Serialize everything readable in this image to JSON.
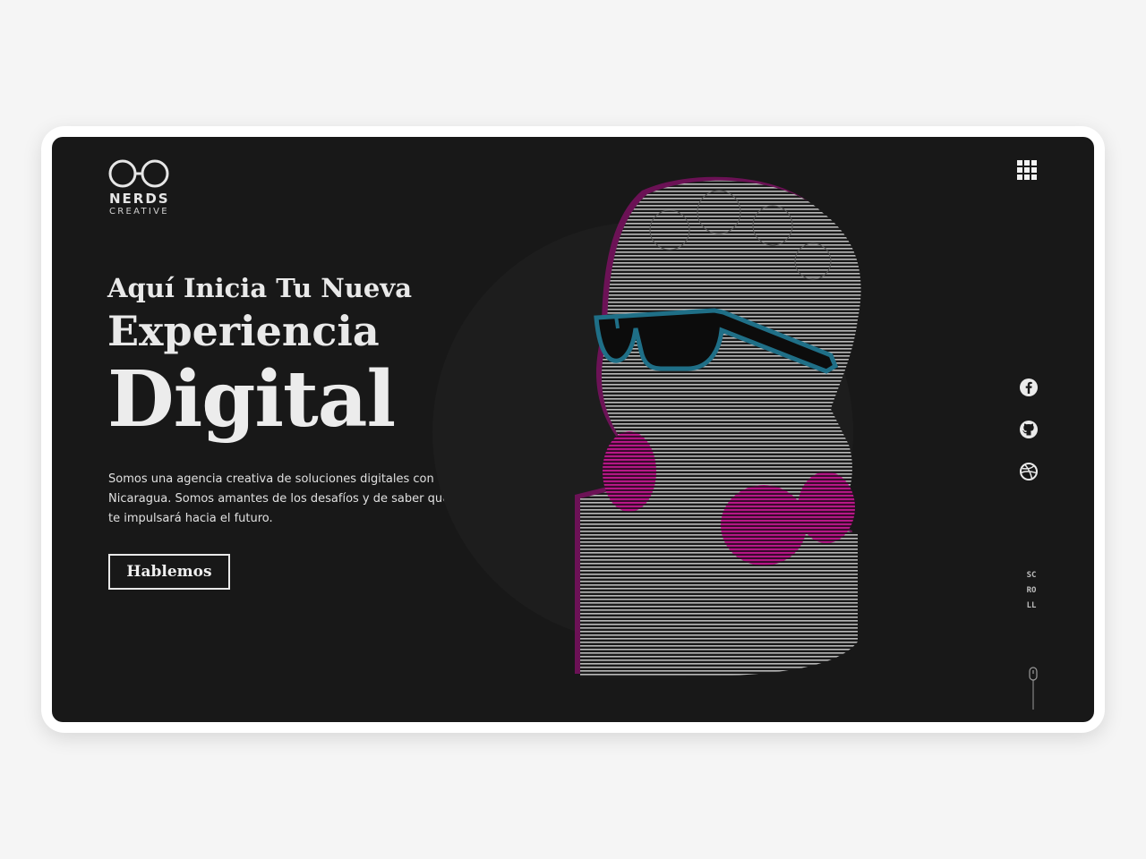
{
  "brand": {
    "name": "NERDS",
    "tagline": "CREATIVE",
    "logo_icon": "glasses-icon"
  },
  "nav": {
    "menu_icon": "grid-menu-icon"
  },
  "hero": {
    "line1": "Aquí Inicia Tu Nueva",
    "line2": "Experiencia",
    "line3": "Digital",
    "description": "Somos una agencia creativa de soluciones digitales con base en Nicaragua. Somos amantes de los desafíos y de saber que nuestro trabajo te impulsará hacia el futuro.",
    "cta_label": "Hablemos"
  },
  "social": [
    {
      "icon": "facebook-icon"
    },
    {
      "icon": "github-icon"
    },
    {
      "icon": "dribbble-icon"
    }
  ],
  "scroll": {
    "label": "SCROLL",
    "icon": "mouse-scroll-icon"
  },
  "colors": {
    "background": "#181818",
    "text": "#e9e9e9",
    "accent_blue": "#1f6f87",
    "accent_magenta": "#c2188f"
  }
}
